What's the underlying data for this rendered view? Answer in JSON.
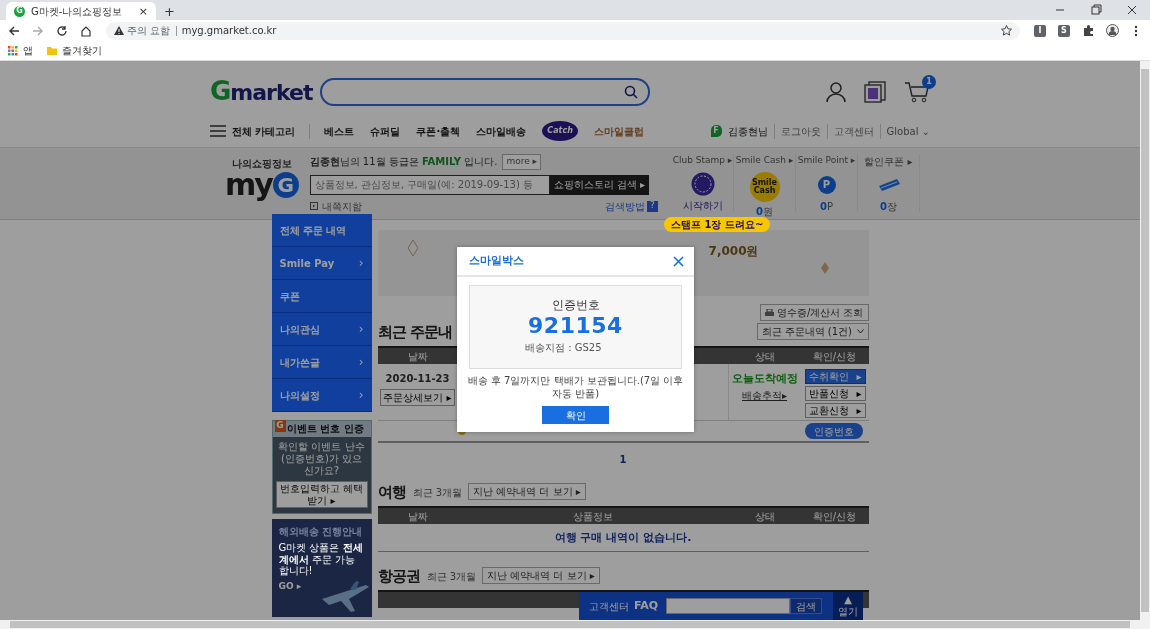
{
  "browser": {
    "tab": {
      "favicon": "G",
      "title": "G마켓-나의쇼핑정보",
      "close": "×"
    },
    "new_tab": "+",
    "security": "주의 요함",
    "url": "myg.gmarket.co.kr",
    "extensions": [
      "I",
      "S"
    ],
    "bookmarks": [
      {
        "label": "앱",
        "kind": "apps"
      },
      {
        "label": "즐겨찾기",
        "kind": "folder"
      }
    ]
  },
  "header": {
    "logo": {
      "mark": "G",
      "text": "market"
    },
    "cart_count": "1",
    "nav": [
      {
        "label": "전체 카테고리",
        "kind": "menu"
      },
      {
        "label": "베스트",
        "kind": "link"
      },
      {
        "label": "슈퍼딜",
        "kind": "link"
      },
      {
        "label": "쿠폰·출첵",
        "kind": "link"
      },
      {
        "label": "스마일배송",
        "kind": "link"
      },
      {
        "label": "Catch",
        "kind": "badge"
      },
      {
        "label": "스마일클럽",
        "kind": "club"
      }
    ],
    "user": {
      "badge": "F",
      "links": [
        "김종현님",
        "로그아웃",
        "고객센터",
        "Global ⌄"
      ]
    }
  },
  "myg": {
    "caption": "나의쇼핑정보",
    "logo": {
      "text": "my",
      "mark": "G"
    },
    "greeting": "**김종현**님의 11월 등급은 **FAMILY** 입니다.",
    "more": "more ▸",
    "search_placeholder": "상품정보, 관심정보, 구매일(예: 2019-09-13) 등",
    "search_button": "쇼핑히스토리 검색 ▸",
    "messages": "내쪽지함",
    "help": "검색방법",
    "help_icon": "?",
    "stats": [
      {
        "label": "Club Stamp ▸",
        "kind": "stamp",
        "value": "시작하기"
      },
      {
        "label": "Smile Cash ▸",
        "kind": "cash",
        "icon_text": "Smile Cash",
        "value": "**0**원"
      },
      {
        "label": "Smile Point ▸",
        "kind": "point",
        "icon_text": "P",
        "value": "**0**P"
      },
      {
        "label": "할인쿠폰 ▸",
        "kind": "coupon",
        "value": "**0**장"
      }
    ],
    "tooltip": "스탬프 1장 드려요~"
  },
  "sidebar": {
    "items": [
      {
        "label": "전체 주문 내역"
      },
      {
        "label": "Smile Pay",
        "chevron": "›"
      },
      {
        "label": "쿠폰"
      },
      {
        "label": "나의관심",
        "chevron": "›"
      },
      {
        "label": "내가쓴글",
        "chevron": "›"
      },
      {
        "label": "나의설정",
        "chevron": "›"
      }
    ],
    "event_box": {
      "badge": "G",
      "title": "이벤트 번호 인증",
      "text": "확인할 이벤트 난수(인증번호)가 있으신가요?",
      "button": "번호입력하고 혜택받기 ▸"
    },
    "shipping_box": {
      "title": "해외배송 진행안내",
      "text": "G마켓 상품은 **전세계에서** 주문 가능합니다!",
      "link": "GO ▸"
    }
  },
  "banner": {
    "text": "7,000원"
  },
  "orders": {
    "title": "최근 주문내",
    "receipt_button": "영수증/계산서 조회",
    "filter": "최근 주문내역 (1건)",
    "columns": [
      "날짜",
      "상태",
      "확인/신청"
    ],
    "rows": [
      {
        "date": "2020-11-23",
        "detail_button": "주문상세보기 ▸",
        "status": "오늘도착예정",
        "tracking": "배송추적▸",
        "actions": [
          {
            "label": "수취확인",
            "arrow": "▸",
            "primary": true
          },
          {
            "label": "반품신청",
            "arrow": "▸",
            "primary": false
          },
          {
            "label": "교환신청",
            "arrow": "▸",
            "primary": false
          }
        ],
        "code_button": "인증번호"
      }
    ],
    "pagination": [
      {
        "label": "1",
        "selected": true
      }
    ]
  },
  "travel": {
    "title": "여행",
    "period": "최근 3개월",
    "more": "지난 예약내역 더 보기 ▸",
    "columns": [
      "날짜",
      "상품정보",
      "상태",
      "확인/신청"
    ],
    "empty": "여행 구매 내역이 없습니다."
  },
  "flights": {
    "title": "항공권",
    "period": "최근 3개월",
    "more": "지난 예약내역 더 보기 ▸"
  },
  "faq": {
    "label": "고객센터",
    "title": "FAQ",
    "button": "검색",
    "toggle_arrow": "▲",
    "toggle": "열기"
  },
  "modal": {
    "title": "스마일박스",
    "code_label": "인증번호",
    "code": "921154",
    "branch": "배송지점 : GS25",
    "note": "배송 후 7일까지만 택배가 보관됩니다.(7일 이후 자동 반품)",
    "confirm": "확인"
  }
}
